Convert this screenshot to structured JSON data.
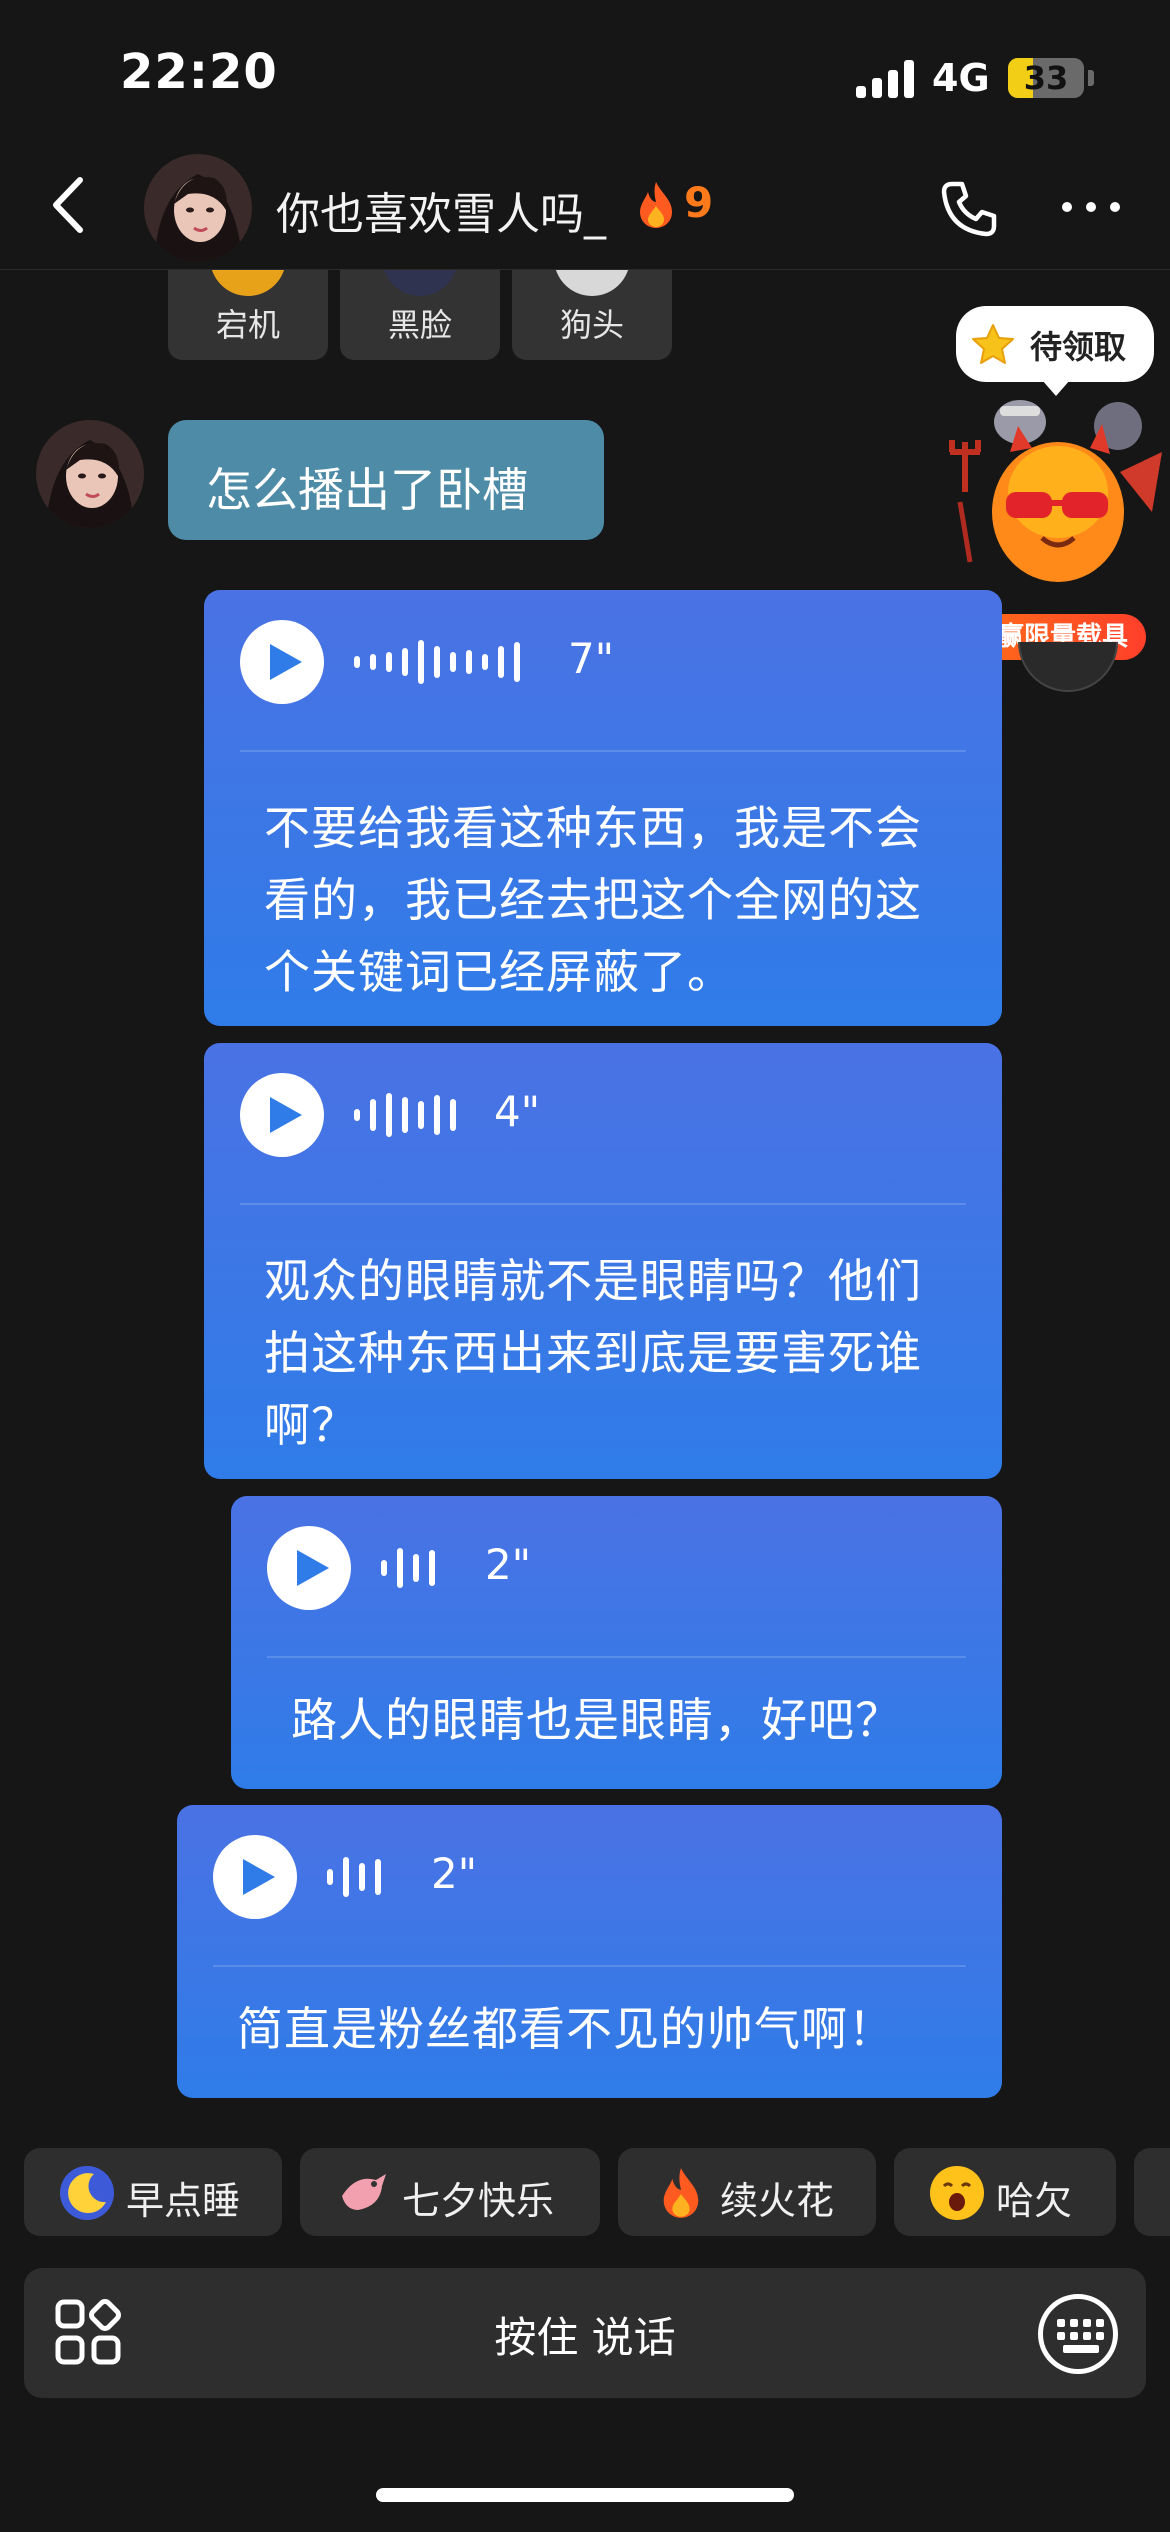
{
  "status_bar": {
    "time": "22:20",
    "network": "4G",
    "battery_level": "33",
    "battery_fraction": 0.33
  },
  "header": {
    "contact_name": "你也喜欢雪人吗_",
    "streak_count": "9",
    "icons": [
      "back-icon",
      "phone-icon",
      "more-icon",
      "fire-icon"
    ]
  },
  "top_reactions": [
    {
      "label": "宕机",
      "color": "#e8a21a"
    },
    {
      "label": "黑脸",
      "color": "#2f3350"
    },
    {
      "label": "狗头",
      "color": "#d8d8d8"
    }
  ],
  "reward": {
    "label": "待领取",
    "promo": "赢限量载具"
  },
  "messages": {
    "received": {
      "text": "怎么播出了卧槽"
    },
    "voice": [
      {
        "duration": "7\"",
        "transcript": "不要给我看这种东西，我是不会看的，我已经去把这个全网的这个关键词已经屏蔽了。"
      },
      {
        "duration": "4\"",
        "transcript": "观众的眼睛就不是眼睛吗？他们拍这种东西出来到底是要害死谁啊？"
      },
      {
        "duration": "2\"",
        "transcript": "路人的眼睛也是眼睛，好吧？"
      },
      {
        "duration": "2\"",
        "transcript": "简直是粉丝都看不见的帅气啊！"
      }
    ]
  },
  "quick_replies": [
    {
      "label": "早点睡",
      "icon": "moon-icon"
    },
    {
      "label": "七夕快乐",
      "icon": "magpie-icon"
    },
    {
      "label": "续火花",
      "icon": "fire-icon"
    },
    {
      "label": "哈欠",
      "icon": "yawn-icon"
    }
  ],
  "input": {
    "hold_to_talk": "按住 说话"
  },
  "colors": {
    "background": "#161616",
    "received_bubble": "#4e8ba6",
    "voice_bubble_top": "#4a72e4",
    "voice_bubble_bottom": "#2f7ce8",
    "accent_orange": "#ff7a1a"
  }
}
